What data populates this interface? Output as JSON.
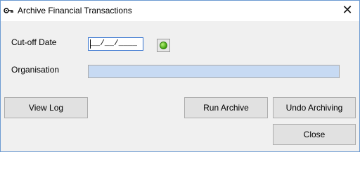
{
  "window": {
    "title": "Archive Financial Transactions",
    "close_glyph": "✕",
    "icon": "key-icon"
  },
  "form": {
    "cutoff_label": "Cut-off Date",
    "cutoff_value": "__/__/____",
    "picker_icon": "green-orb-icon",
    "organisation_label": "Organisation",
    "organisation_value": ""
  },
  "buttons": {
    "view_log": "View Log",
    "run_archive": "Run Archive",
    "undo_archiving": "Undo  Archiving",
    "close": "Close"
  },
  "colors": {
    "title_bg": "#ffffff",
    "window_bg": "#f0f0f0",
    "date_border": "#2f6fcf",
    "organisation_bg": "#c7daf3",
    "button_bg": "#e1e1e1"
  }
}
